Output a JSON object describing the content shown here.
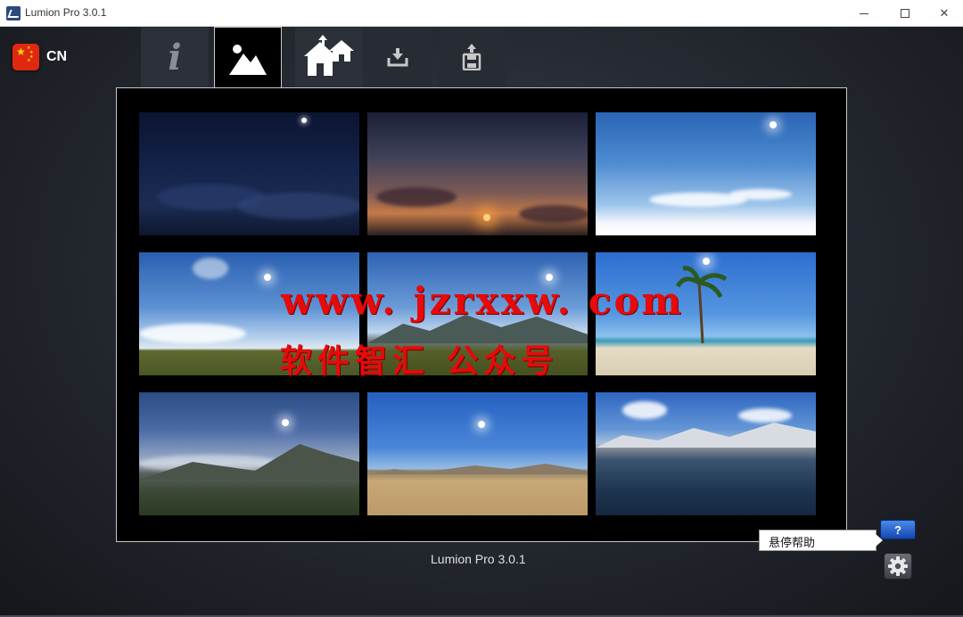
{
  "window": {
    "title": "Lumion Pro  3.0.1",
    "app_icon": "lumion-logo-icon",
    "minimize_icon": "minimize-icon",
    "maximize_icon": "maximize-icon",
    "close_icon": "close-icon",
    "close_glyph": "✕"
  },
  "language": {
    "flag": "china-flag-icon",
    "code": "CN"
  },
  "tabs": [
    {
      "id": "info",
      "icon": "info-icon",
      "selected": false
    },
    {
      "id": "landscape",
      "icon": "mountain-landscape-icon",
      "selected": true
    },
    {
      "id": "project",
      "icon": "houses-icon",
      "selected": false
    },
    {
      "id": "import",
      "icon": "import-icon",
      "selected": false
    },
    {
      "id": "save",
      "icon": "save-disk-icon",
      "selected": false
    }
  ],
  "scenes": [
    {
      "id": "night"
    },
    {
      "id": "sunset"
    },
    {
      "id": "white-plane"
    },
    {
      "id": "grassland"
    },
    {
      "id": "mountain-grass"
    },
    {
      "id": "tropical-beach"
    },
    {
      "id": "lake-valley"
    },
    {
      "id": "desert"
    },
    {
      "id": "snow-lake"
    }
  ],
  "watermark": {
    "line1": "www. jzrxxw. com",
    "line2": "软件智汇 公众号"
  },
  "footer": {
    "version": "Lumion Pro  3.0.1"
  },
  "help": {
    "button_label": "?",
    "tooltip": "悬停帮助"
  },
  "settings": {
    "icon": "gear-icon"
  },
  "colors": {
    "accent_blue": "#1e5fd0",
    "watermark_red": "#e80a0a",
    "flag_red": "#de2910"
  }
}
